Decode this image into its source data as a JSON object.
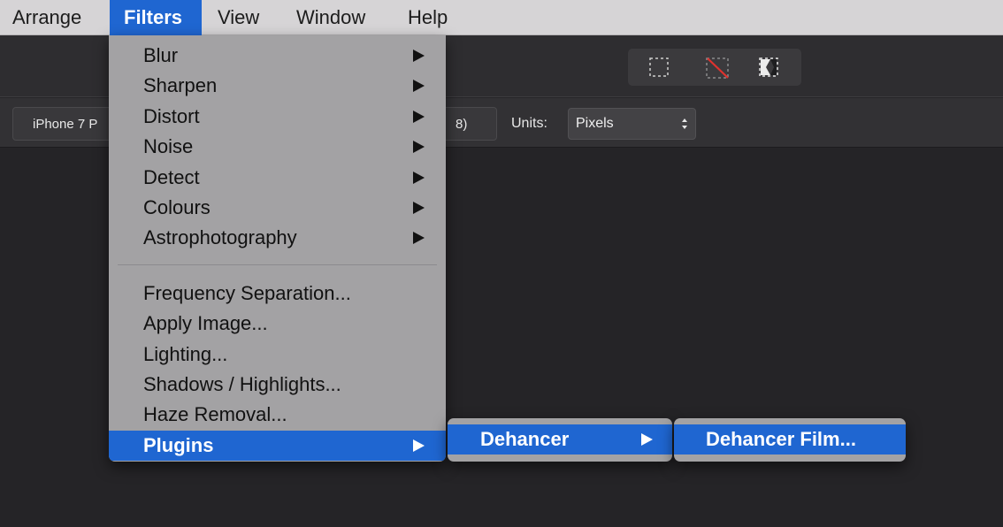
{
  "menubar": {
    "items": [
      {
        "label": "Arrange"
      },
      {
        "label": "Filters"
      },
      {
        "label": "View"
      },
      {
        "label": "Window"
      },
      {
        "label": "Help"
      }
    ],
    "active_item": "Filters"
  },
  "toolbar": {
    "selection_tools": [
      {
        "icon": "marquee-select-icon"
      },
      {
        "icon": "deselect-icon"
      },
      {
        "icon": "invert-selection-icon"
      }
    ]
  },
  "context_toolbar": {
    "preset_text": "iPhone 7 P",
    "preset_text_tail": "8)",
    "units_label": "Units:",
    "units_value": "Pixels"
  },
  "filters_menu": {
    "group1": [
      {
        "label": "Blur",
        "has_submenu": true
      },
      {
        "label": "Sharpen",
        "has_submenu": true
      },
      {
        "label": "Distort",
        "has_submenu": true
      },
      {
        "label": "Noise",
        "has_submenu": true
      },
      {
        "label": "Detect",
        "has_submenu": true
      },
      {
        "label": "Colours",
        "has_submenu": true
      },
      {
        "label": "Astrophotography",
        "has_submenu": true
      }
    ],
    "group2": [
      {
        "label": "Frequency Separation..."
      },
      {
        "label": "Apply Image..."
      },
      {
        "label": "Lighting..."
      },
      {
        "label": "Shadows / Highlights..."
      },
      {
        "label": "Haze Removal..."
      },
      {
        "label": "Plugins",
        "has_submenu": true,
        "highlighted": true
      }
    ]
  },
  "plugins_submenu": {
    "items": [
      {
        "label": "Dehancer",
        "has_submenu": true,
        "highlighted": true
      }
    ]
  },
  "dehancer_submenu": {
    "items": [
      {
        "label": "Dehancer Film...",
        "highlighted": true
      }
    ]
  },
  "colors": {
    "highlight": "#1f66d1",
    "menu_background": "#a3a2a4",
    "menubar_background": "#d6d4d6",
    "canvas_background": "#252427",
    "deselect_accent": "#e0322e"
  }
}
